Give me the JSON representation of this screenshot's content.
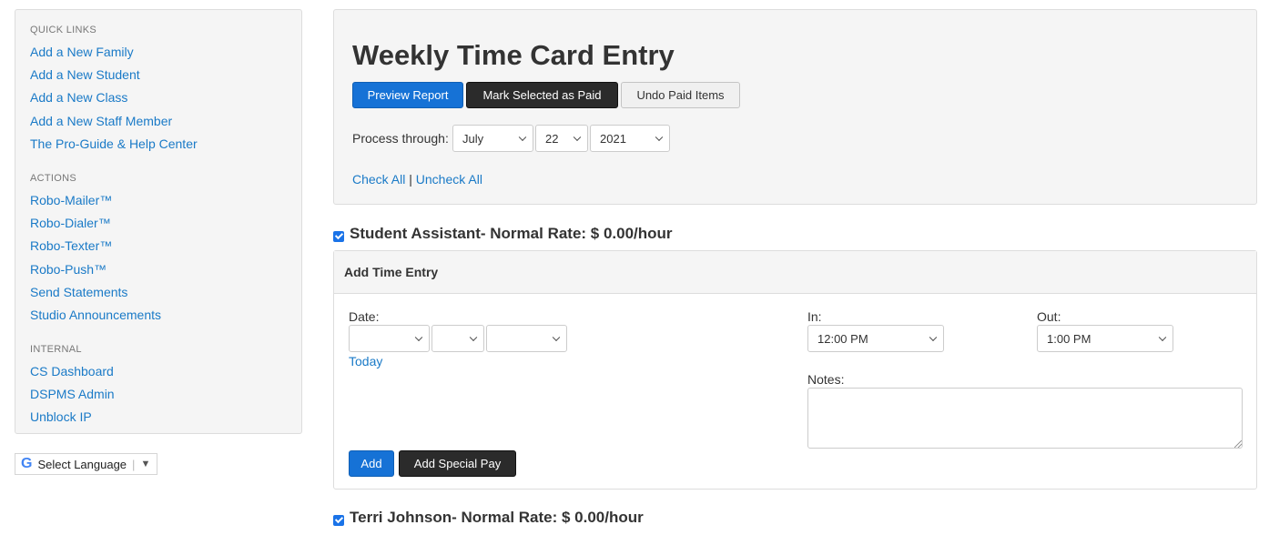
{
  "sidebar": {
    "quick_links_heading": "QUICK LINKS",
    "quick_links": [
      "Add a New Family",
      "Add a New Student",
      "Add a New Class",
      "Add a New Staff Member",
      "The Pro-Guide & Help Center"
    ],
    "actions_heading": "ACTIONS",
    "actions": [
      "Robo-Mailer™",
      "Robo-Dialer™",
      "Robo-Texter™",
      "Robo-Push™",
      "Send Statements",
      "Studio Announcements"
    ],
    "internal_heading": "INTERNAL",
    "internal": [
      "CS Dashboard",
      "DSPMS Admin",
      "Unblock IP"
    ]
  },
  "language_widget": {
    "logo": "G",
    "label": "Select Language",
    "arrow": "▼"
  },
  "header": {
    "title": "Weekly Time Card Entry",
    "preview_label": "Preview Report",
    "mark_paid_label": "Mark Selected as Paid",
    "undo_label": "Undo Paid Items",
    "process_label": "Process through:",
    "month": "July",
    "day": "22",
    "year": "2021",
    "check_all": "Check All",
    "separator": "|",
    "uncheck_all": "Uncheck All"
  },
  "staff": [
    {
      "name": "Student Assistant- Normal Rate: $ 0.00/hour",
      "checked": true
    },
    {
      "name": "Terri Johnson- Normal Rate: $ 0.00/hour",
      "checked": true
    }
  ],
  "entry": {
    "heading": "Add Time Entry",
    "date_label": "Date:",
    "date_month": "",
    "date_day": "",
    "date_year": "",
    "today_link": "Today",
    "in_label": "In:",
    "in_value": "12:00 PM",
    "out_label": "Out:",
    "out_value": "1:00 PM",
    "notes_label": "Notes:",
    "notes_value": "",
    "add_label": "Add",
    "special_pay_label": "Add Special Pay"
  },
  "colors": {
    "primary": "#1672d6",
    "dark": "#2b2b2b",
    "link": "#1a7ac7",
    "panel": "#f5f5f5"
  }
}
